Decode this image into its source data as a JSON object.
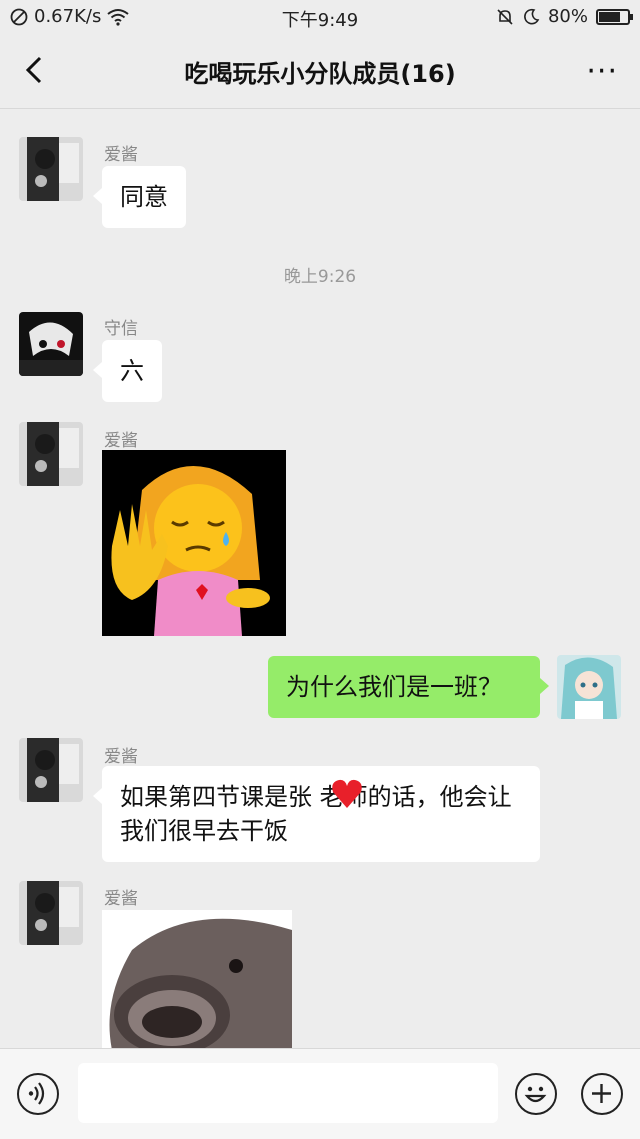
{
  "status_bar": {
    "network_speed": "0.67K/s",
    "time": "下午9:49",
    "battery": "80%",
    "battery_level": 0.8
  },
  "nav": {
    "title": "吃喝玩乐小分队成员(16)",
    "more": "···"
  },
  "messages": [
    {
      "sender": "爱酱",
      "text": "同意",
      "side": "left"
    },
    {
      "timestamp": "晚上9:26"
    },
    {
      "sender": "守信",
      "text": "六",
      "side": "left"
    },
    {
      "sender": "爱酱",
      "sticker": "crying-girl-emoji-sticker",
      "side": "left"
    },
    {
      "text": "为什么我们是一班？",
      "side": "right"
    },
    {
      "sender": "爱酱",
      "text": "如果第四节课是张 老师的话，他会让我们很早去干饭",
      "side": "left"
    },
    {
      "sender": "爱酱",
      "sticker": "fish-face-sticker",
      "side": "left"
    }
  ],
  "bottom_bar": {
    "input_value": "",
    "icons": [
      "voice-icon",
      "emoji-icon",
      "plus-icon"
    ]
  },
  "colors": {
    "background": "#ededed",
    "outgoing_bubble": "#95ec69",
    "incoming_bubble": "#ffffff"
  }
}
